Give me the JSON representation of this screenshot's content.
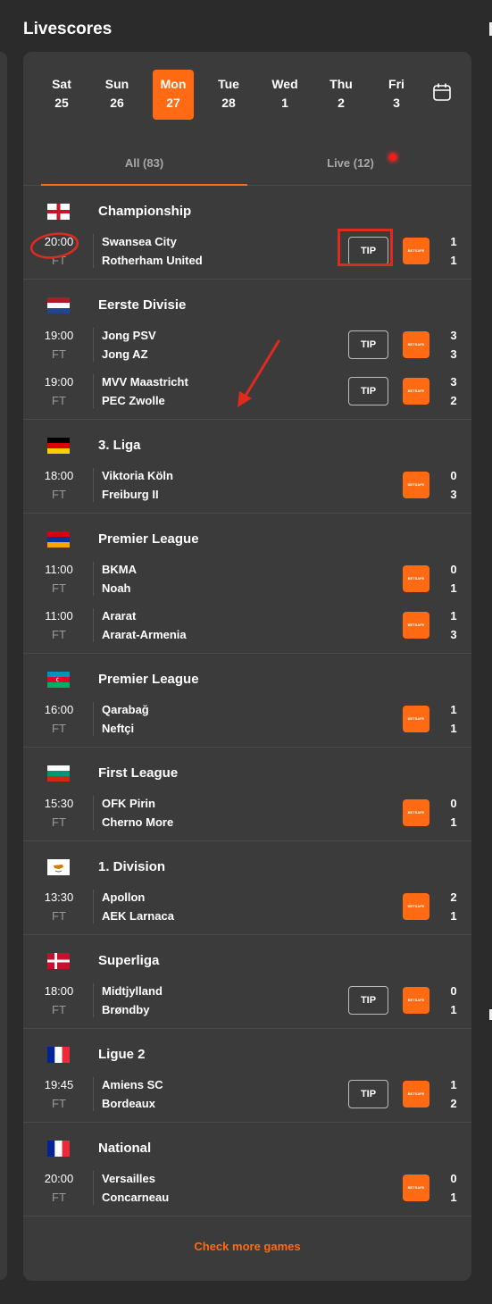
{
  "page_title": "Livescores",
  "dates": [
    {
      "day": "Sat",
      "num": "25",
      "active": false
    },
    {
      "day": "Sun",
      "num": "26",
      "active": false
    },
    {
      "day": "Mon",
      "num": "27",
      "active": true
    },
    {
      "day": "Tue",
      "num": "28",
      "active": false
    },
    {
      "day": "Wed",
      "num": "1",
      "active": false
    },
    {
      "day": "Thu",
      "num": "2",
      "active": false
    },
    {
      "day": "Fri",
      "num": "3",
      "active": false
    }
  ],
  "tabs": {
    "all": "All (83)",
    "live": "Live (12)"
  },
  "tip_label": "TIP",
  "bet_label": "BETSAFE",
  "more_label": "Check more games",
  "colors": {
    "accent": "#ff6a13",
    "panel": "#3b3b3b",
    "background": "#2b2b2b",
    "annotation": "#e02a1d"
  },
  "leagues": [
    {
      "name": "Championship",
      "flag": "england",
      "matches": [
        {
          "time": "20:00",
          "status": "FT",
          "home": "Swansea City",
          "away": "Rotherham United",
          "hs": "1",
          "as": "1",
          "tip": true
        }
      ]
    },
    {
      "name": "Eerste Divisie",
      "flag": "netherlands",
      "matches": [
        {
          "time": "19:00",
          "status": "FT",
          "home": "Jong PSV",
          "away": "Jong AZ",
          "hs": "3",
          "as": "3",
          "tip": true
        },
        {
          "time": "19:00",
          "status": "FT",
          "home": "MVV Maastricht",
          "away": "PEC Zwolle",
          "hs": "3",
          "as": "2",
          "tip": true
        }
      ]
    },
    {
      "name": "3. Liga",
      "flag": "germany",
      "matches": [
        {
          "time": "18:00",
          "status": "FT",
          "home": "Viktoria Köln",
          "away": "Freiburg II",
          "hs": "0",
          "as": "3",
          "tip": false
        }
      ]
    },
    {
      "name": "Premier League",
      "flag": "armenia",
      "matches": [
        {
          "time": "11:00",
          "status": "FT",
          "home": "BKMA",
          "away": "Noah",
          "hs": "0",
          "as": "1",
          "tip": false
        },
        {
          "time": "11:00",
          "status": "FT",
          "home": "Ararat",
          "away": "Ararat-Armenia",
          "hs": "1",
          "as": "3",
          "tip": false
        }
      ]
    },
    {
      "name": "Premier League",
      "flag": "azerbaijan",
      "matches": [
        {
          "time": "16:00",
          "status": "FT",
          "home": "Qarabağ",
          "away": "Neftçi",
          "hs": "1",
          "as": "1",
          "tip": false
        }
      ]
    },
    {
      "name": "First League",
      "flag": "bulgaria",
      "matches": [
        {
          "time": "15:30",
          "status": "FT",
          "home": "OFK Pirin",
          "away": "Cherno More",
          "hs": "0",
          "as": "1",
          "tip": false
        }
      ]
    },
    {
      "name": "1. Division",
      "flag": "cyprus",
      "matches": [
        {
          "time": "13:30",
          "status": "FT",
          "home": "Apollon",
          "away": "AEK Larnaca",
          "hs": "2",
          "as": "1",
          "tip": false
        }
      ]
    },
    {
      "name": "Superliga",
      "flag": "denmark",
      "matches": [
        {
          "time": "18:00",
          "status": "FT",
          "home": "Midtjylland",
          "away": "Brøndby",
          "hs": "0",
          "as": "1",
          "tip": true
        }
      ]
    },
    {
      "name": "Ligue 2",
      "flag": "france",
      "matches": [
        {
          "time": "19:45",
          "status": "FT",
          "home": "Amiens SC",
          "away": "Bordeaux",
          "hs": "1",
          "as": "2",
          "tip": true
        }
      ]
    },
    {
      "name": "National",
      "flag": "france",
      "matches": [
        {
          "time": "20:00",
          "status": "FT",
          "home": "Versailles",
          "away": "Concarneau",
          "hs": "0",
          "as": "1",
          "tip": false
        }
      ]
    }
  ]
}
